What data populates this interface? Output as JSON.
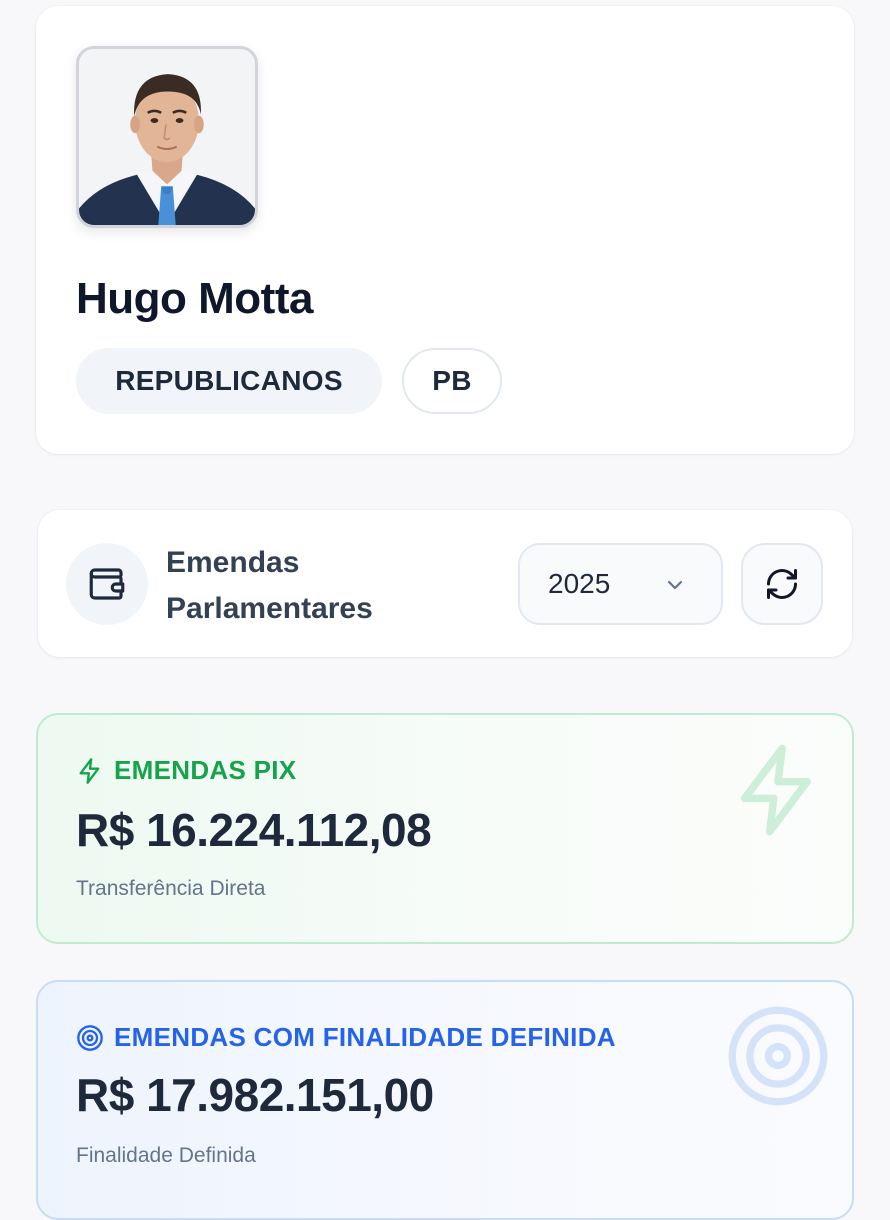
{
  "profile": {
    "photo_alt": "Hugo Motta",
    "name": "Hugo Motta",
    "party": "REPUBLICANOS",
    "state": "PB"
  },
  "header": {
    "icon": "wallet-icon",
    "title": "Emendas Parlamentares",
    "year_selected": "2025",
    "refresh_icon": "refresh-icon"
  },
  "cards": {
    "pix": {
      "icon": "lightning-icon",
      "label": "EMENDAS PIX",
      "value": "R$ 16.224.112,08",
      "subtitle": "Transferência Direta",
      "accent": "#16a34a"
    },
    "finalidade": {
      "icon": "target-icon",
      "label": "EMENDAS COM FINALIDADE DEFINIDA",
      "value": "R$ 17.982.151,00",
      "subtitle": "Finalidade Definida",
      "accent": "#2563eb"
    }
  }
}
